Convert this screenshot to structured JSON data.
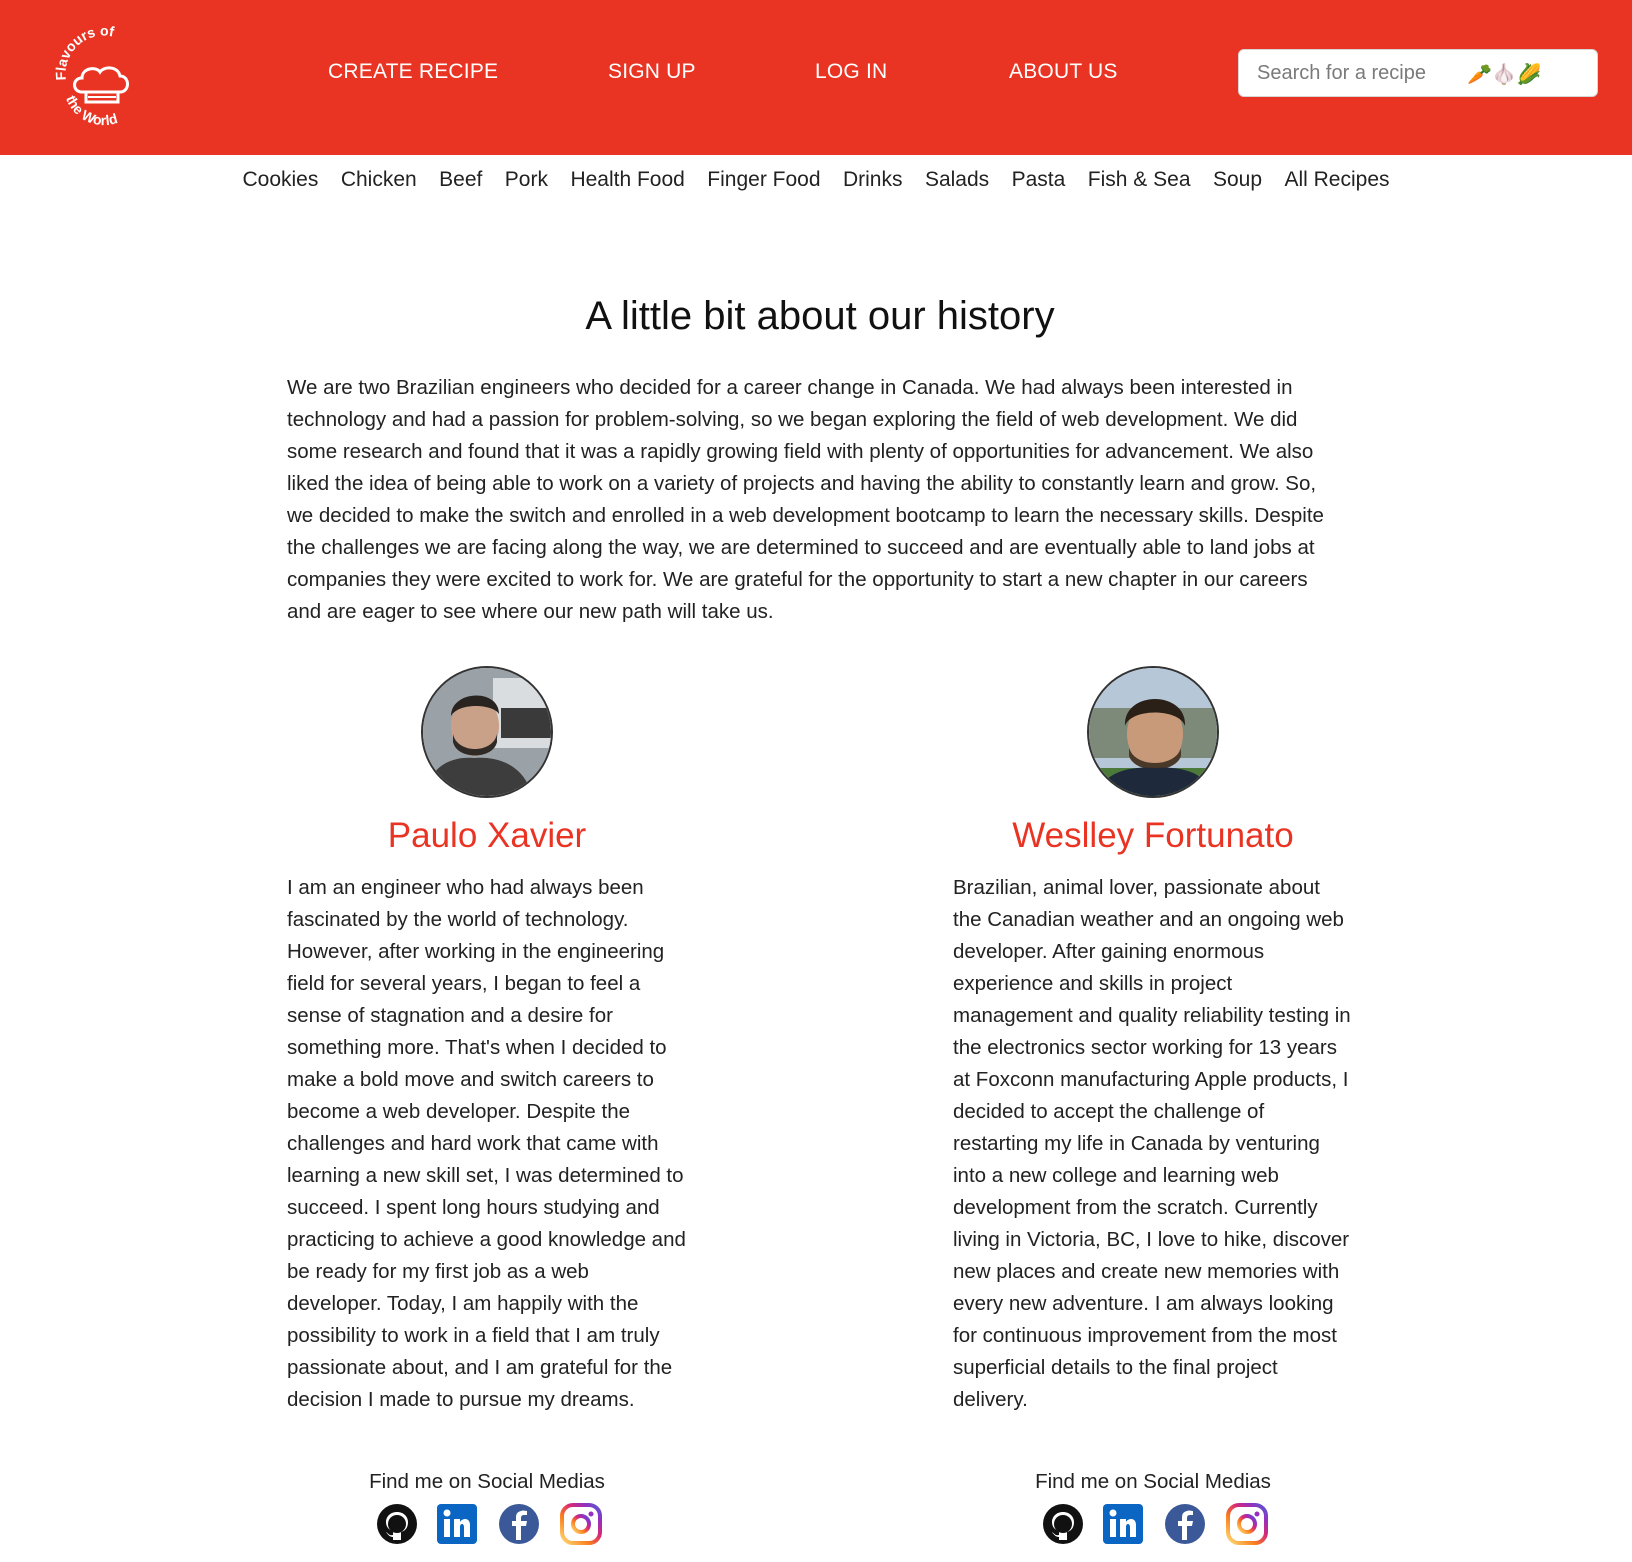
{
  "header": {
    "logo_text_top": "Flavours of",
    "logo_text_bottom": "the World",
    "nav": {
      "create_recipe": "CREATE RECIPE",
      "sign_up": "SIGN UP",
      "log_in": "LOG IN",
      "about_us": "ABOUT US"
    },
    "search": {
      "placeholder": "Search for a recipe",
      "emoji": "🥕🧄🌽"
    }
  },
  "categories": [
    "Cookies",
    "Chicken",
    "Beef",
    "Pork",
    "Health Food",
    "Finger Food",
    "Drinks",
    "Salads",
    "Pasta",
    "Fish & Sea",
    "Soup",
    "All Recipes"
  ],
  "about": {
    "title": "A little bit about our history",
    "intro": "We are two Brazilian engineers who decided for a career change in Canada. We had always been interested in technology and had a passion for problem-solving, so we began exploring the field of web development. We did some research and found that it was a rapidly growing field with plenty of opportunities for advancement. We also liked the idea of being able to work on a variety of projects and having the ability to constantly learn and grow. So, we decided to make the switch and enrolled in a web development bootcamp to learn the necessary skills. Despite the challenges we are facing along the way, we are determined to succeed and are eventually able to land jobs at companies they were excited to work for. We are grateful for the opportunity to start a new chapter in our careers and are eager to see where our new path will take us."
  },
  "team": [
    {
      "name": "Paulo Xavier",
      "bio": "I am an engineer who had always been fascinated by the world of technology. However, after working in the engineering field for several years, I began to feel a sense of stagnation and a desire for something more. That's when I decided to make a bold move and switch careers to become a web developer. Despite the challenges and hard work that came with learning a new skill set, I was determined to succeed. I spent long hours studying and practicing to achieve a good knowledge and be ready for my first job as a web developer. Today, I am happily with the possibility to work in a field that I am truly passionate about, and I am grateful for the decision I made to pursue my dreams.",
      "social_label": "Find me on Social Medias"
    },
    {
      "name": "Weslley Fortunato",
      "bio": "Brazilian, animal lover, passionate about the Canadian weather and an ongoing web developer. After gaining enormous experience and skills in project management and quality reliability testing in the electronics sector working for 13 years at Foxconn manufacturing Apple products, I decided to accept the challenge of restarting my life in Canada by venturing into a new college and learning web development from the scratch. Currently living in Victoria, BC, I love to hike, discover new places and create new memories with every new adventure. I am always looking for continuous improvement from the most superficial details to the final project delivery.",
      "social_label": "Find me on Social Medias"
    }
  ],
  "social_icons": [
    "github-icon",
    "linkedin-icon",
    "facebook-icon",
    "instagram-icon"
  ],
  "colors": {
    "brand_red": "#e93424",
    "white": "#ffffff",
    "text": "#222222",
    "linkedin": "#0a66c2",
    "facebook": "#3b5998"
  }
}
